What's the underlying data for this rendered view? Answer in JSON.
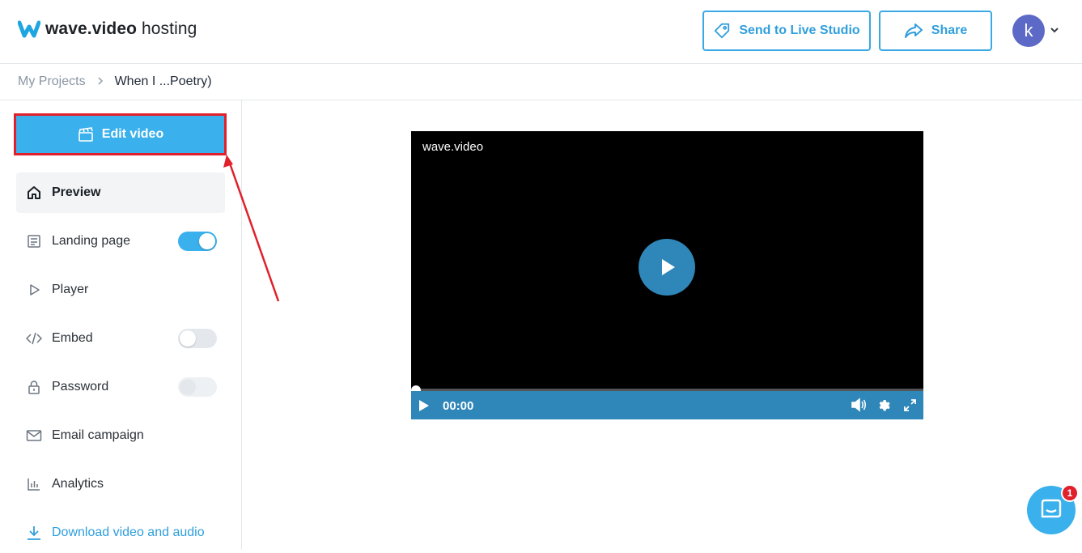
{
  "header": {
    "logo_bold": "wave.video",
    "logo_light": " hosting",
    "send_live_label": "Send to Live Studio",
    "share_label": "Share",
    "avatar_initial": "k"
  },
  "breadcrumb": {
    "root": "My Projects",
    "separator": ">",
    "current": "When I ...Poetry)"
  },
  "sidebar": {
    "edit_label": "Edit video",
    "items": [
      {
        "label": "Preview",
        "icon": "home-icon",
        "active": true
      },
      {
        "label": "Landing page",
        "icon": "page-icon",
        "toggle": "on"
      },
      {
        "label": "Player",
        "icon": "play-outline-icon"
      },
      {
        "label": "Embed",
        "icon": "code-icon",
        "toggle": "off"
      },
      {
        "label": "Password",
        "icon": "lock-icon",
        "toggle": "disabled"
      },
      {
        "label": "Email campaign",
        "icon": "mail-icon"
      },
      {
        "label": "Analytics",
        "icon": "bar-chart-icon"
      },
      {
        "label": "Download video and audio",
        "icon": "download-icon"
      }
    ]
  },
  "player": {
    "brand": "wave.video",
    "time": "00:00"
  },
  "chat": {
    "badge": "1"
  },
  "colors": {
    "accent": "#3ab0ec",
    "player_bar": "#2f86b8",
    "highlight": "#e0202a"
  }
}
